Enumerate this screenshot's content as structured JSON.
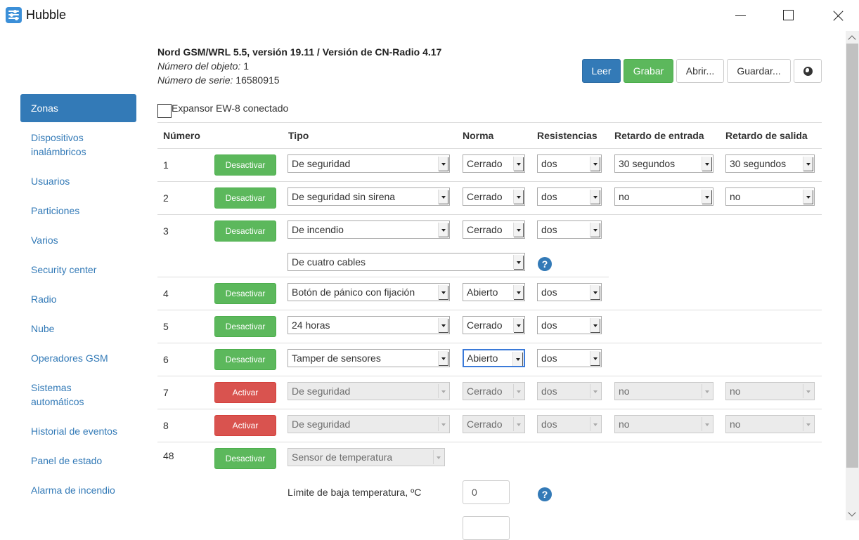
{
  "window": {
    "title": "Hubble"
  },
  "sidebar": {
    "items": [
      {
        "label": "Zonas"
      },
      {
        "label": "Dispositivos inalámbricos"
      },
      {
        "label": "Usuarios"
      },
      {
        "label": "Particiones"
      },
      {
        "label": "Varios"
      },
      {
        "label": "Security center"
      },
      {
        "label": "Radio"
      },
      {
        "label": "Nube"
      },
      {
        "label": "Operadores GSM"
      },
      {
        "label": "Sistemas automáticos"
      },
      {
        "label": "Historial de eventos"
      },
      {
        "label": "Panel de estado"
      },
      {
        "label": "Alarma de incendio"
      }
    ]
  },
  "header": {
    "device_title": "Nord GSM/WRL 5.5, versión 19.11 / Versión de CN-Radio 4.17",
    "object_label": "Número del objeto:",
    "object_value": "1",
    "serial_label": "Número de serie:",
    "serial_value": "16580915"
  },
  "toolbar": {
    "read": "Leer",
    "write": "Grabar",
    "open": "Abrir...",
    "save": "Guardar..."
  },
  "expander": {
    "label": "Expansor EW-8 conectado",
    "checked": false
  },
  "table": {
    "headers": {
      "number": "Número",
      "type": "Tipo",
      "norm": "Norma",
      "resistances": "Resistencias",
      "entry_delay": "Retardo de entrada",
      "exit_delay": "Retardo de salida"
    },
    "rows": [
      {
        "number": "1",
        "action": "Desactivar",
        "type": "De seguridad",
        "norm": "Cerrado",
        "resist": "dos",
        "entry": "30 segundos",
        "exit": "30 segundos"
      },
      {
        "number": "2",
        "action": "Desactivar",
        "type": "De seguridad sin sirena",
        "norm": "Cerrado",
        "resist": "dos",
        "entry": "no",
        "exit": "no"
      },
      {
        "number": "3",
        "action": "Desactivar",
        "type": "De incendio",
        "norm": "Cerrado",
        "resist": "dos",
        "wiring": "De cuatro cables"
      },
      {
        "number": "4",
        "action": "Desactivar",
        "type": "Botón de pánico con fijación",
        "norm": "Abierto",
        "resist": "dos"
      },
      {
        "number": "5",
        "action": "Desactivar",
        "type": "24 horas",
        "norm": "Cerrado",
        "resist": "dos"
      },
      {
        "number": "6",
        "action": "Desactivar",
        "type": "Tamper de sensores",
        "norm": "Abierto",
        "resist": "dos"
      },
      {
        "number": "7",
        "action": "Activar",
        "type": "De seguridad",
        "norm": "Cerrado",
        "resist": "dos",
        "entry": "no",
        "exit": "no"
      },
      {
        "number": "8",
        "action": "Activar",
        "type": "De seguridad",
        "norm": "Cerrado",
        "resist": "dos",
        "entry": "no",
        "exit": "no"
      },
      {
        "number": "48",
        "action": "Desactivar",
        "type": "Sensor de temperatura"
      }
    ],
    "temperature": {
      "low_label": "Límite de baja temperatura, ºC",
      "low_value": "0"
    }
  },
  "colors": {
    "primary": "#337ab7",
    "success": "#5cb85c",
    "danger": "#d9534f"
  },
  "icons": {
    "help": "question-circle-icon",
    "language": "globe-icon"
  }
}
